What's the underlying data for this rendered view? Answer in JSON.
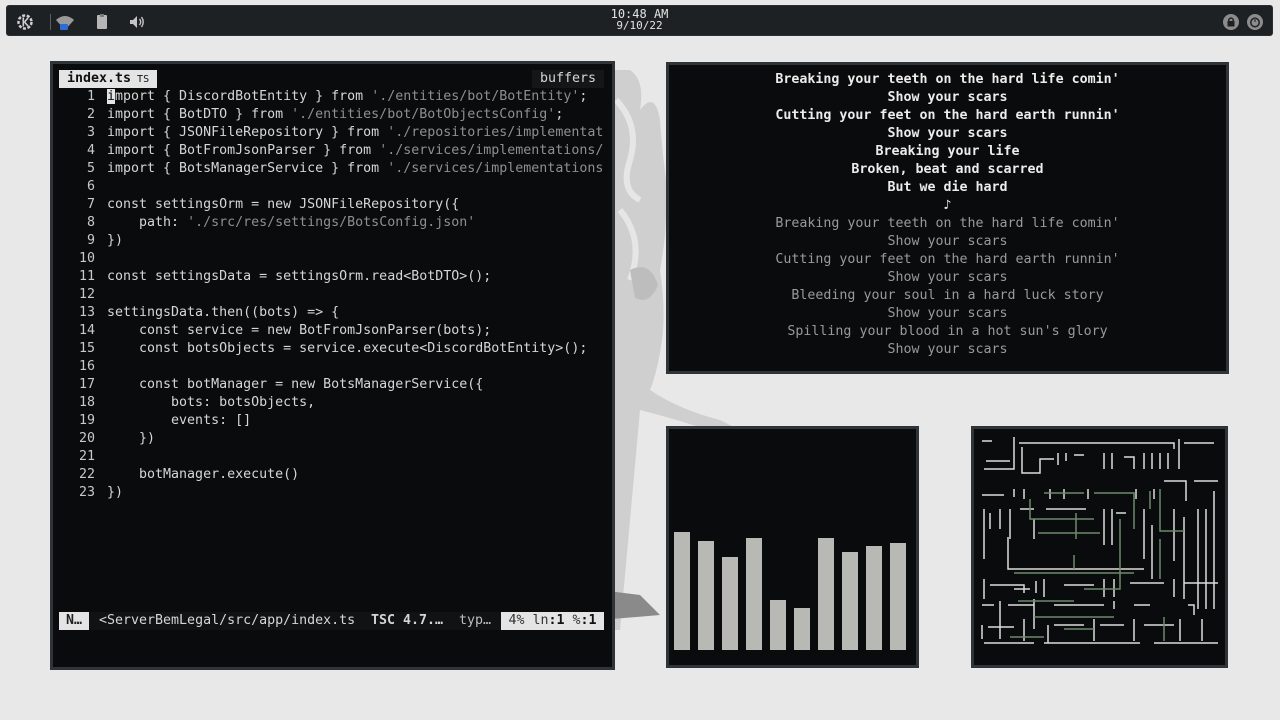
{
  "panel": {
    "time": "10:48 AM",
    "date": "9/10/22"
  },
  "editor": {
    "tab_active": "index.ts",
    "tab_active_badge": "TS",
    "tab_right": "buffers",
    "lines": [
      {
        "n": "1",
        "segs": [
          {
            "t": "import { DiscordBotEntity } from "
          },
          {
            "t": "'./entities/bot/BotEntity'",
            "s": 1
          },
          {
            "t": ";"
          }
        ]
      },
      {
        "n": "2",
        "segs": [
          {
            "t": "import { BotDTO } from "
          },
          {
            "t": "'./entities/bot/BotObjectsConfig'",
            "s": 1
          },
          {
            "t": ";"
          }
        ]
      },
      {
        "n": "3",
        "segs": [
          {
            "t": "import { JSONFileRepository } from "
          },
          {
            "t": "'./repositories/implementat",
            "s": 1
          }
        ]
      },
      {
        "n": "4",
        "segs": [
          {
            "t": "import { BotFromJsonParser } from "
          },
          {
            "t": "'./services/implementations/",
            "s": 1
          }
        ]
      },
      {
        "n": "5",
        "segs": [
          {
            "t": "import { BotsManagerService } from "
          },
          {
            "t": "'./services/implementations",
            "s": 1
          }
        ]
      },
      {
        "n": "6",
        "segs": []
      },
      {
        "n": "7",
        "segs": [
          {
            "t": "const settingsOrm = new JSONFileRepository({"
          }
        ]
      },
      {
        "n": "8",
        "segs": [
          {
            "t": "    path: "
          },
          {
            "t": "'./src/res/settings/BotsConfig.json'",
            "s": 1
          }
        ]
      },
      {
        "n": "9",
        "segs": [
          {
            "t": "})"
          }
        ]
      },
      {
        "n": "10",
        "segs": []
      },
      {
        "n": "11",
        "segs": [
          {
            "t": "const settingsData = settingsOrm.read<BotDTO>();"
          }
        ]
      },
      {
        "n": "12",
        "segs": []
      },
      {
        "n": "13",
        "segs": [
          {
            "t": "settingsData.then((bots) => {"
          }
        ]
      },
      {
        "n": "14",
        "segs": [
          {
            "t": "    const service = new BotFromJsonParser(bots);"
          }
        ]
      },
      {
        "n": "15",
        "segs": [
          {
            "t": "    const botsObjects = service.execute<DiscordBotEntity>();"
          }
        ]
      },
      {
        "n": "16",
        "segs": []
      },
      {
        "n": "17",
        "segs": [
          {
            "t": "    const botManager = new BotsManagerService({"
          }
        ]
      },
      {
        "n": "18",
        "segs": [
          {
            "t": "        bots: botsObjects,"
          }
        ]
      },
      {
        "n": "19",
        "segs": [
          {
            "t": "        events: []"
          }
        ]
      },
      {
        "n": "20",
        "segs": [
          {
            "t": "    })"
          }
        ]
      },
      {
        "n": "21",
        "segs": []
      },
      {
        "n": "22",
        "segs": [
          {
            "t": "    botManager.execute()"
          }
        ]
      },
      {
        "n": "23",
        "segs": [
          {
            "t": "})"
          }
        ]
      }
    ],
    "status": {
      "mode": "N…",
      "file": "<ServerBemLegal/src/app/index.ts",
      "tsc": "TSC 4.7.…",
      "filetype": "typ…",
      "percent": "4%",
      "ln_label": "ln",
      "ln": ":1",
      "col_label": "%",
      "col": ":1"
    }
  },
  "lyrics": {
    "lines": [
      {
        "text": "Breaking your teeth on the hard life comin'",
        "bold": true
      },
      {
        "text": "Show your scars",
        "bold": true
      },
      {
        "text": "Cutting your feet on the hard earth runnin'",
        "bold": true
      },
      {
        "text": "Show your scars",
        "bold": true
      },
      {
        "text": "Breaking your life",
        "bold": true
      },
      {
        "text": "Broken, beat and scarred",
        "bold": true
      },
      {
        "text": "But we die hard",
        "bold": true
      },
      {
        "text": "♪",
        "bold": true
      },
      {
        "text": "Breaking your teeth on the hard life comin'",
        "bold": false
      },
      {
        "text": "Show your scars",
        "bold": false
      },
      {
        "text": "Cutting your feet on the hard earth runnin'",
        "bold": false
      },
      {
        "text": "Show your scars",
        "bold": false
      },
      {
        "text": "Bleeding your soul in a hard luck story",
        "bold": false
      },
      {
        "text": "Show your scars",
        "bold": false
      },
      {
        "text": "Spilling your blood in a hot sun's glory",
        "bold": false
      },
      {
        "text": "Show your scars",
        "bold": false
      }
    ]
  },
  "visualizer": {
    "bar_color": "#b8b8b4",
    "levels": [
      0.74,
      0.68,
      0.58,
      0.7,
      0.31,
      0.26,
      0.7,
      0.61,
      0.65,
      0.67
    ]
  },
  "icons": {
    "launcher": "kde-launcher-icon",
    "wifi": "wifi-icon",
    "clipboard": "clipboard-icon",
    "volume": "volume-icon",
    "lock": "lock-icon",
    "power": "power-icon"
  }
}
